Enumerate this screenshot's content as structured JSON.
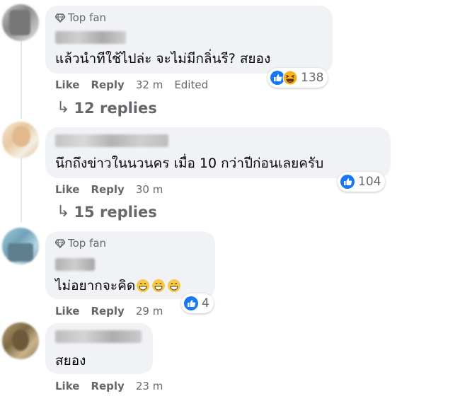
{
  "comments": [
    {
      "badge": "Top fan",
      "text": "แล้วนำทีใช้ไปล่ะ จะไม่มีกลิ่นรี? สยอง",
      "reactions": {
        "icons": [
          "like",
          "haha"
        ],
        "count": "138"
      },
      "actions": {
        "like": "Like",
        "reply": "Reply",
        "time": "32 m",
        "edited": "Edited"
      },
      "replies": {
        "arrow": "↳",
        "label": "12 replies"
      }
    },
    {
      "text": "นึกถึงข่าวในนวนคร เมื่อ 10 กว่าปีก่อนเลยครับ",
      "reactions": {
        "icons": [
          "like"
        ],
        "count": "104"
      },
      "actions": {
        "like": "Like",
        "reply": "Reply",
        "time": "30 m"
      },
      "replies": {
        "arrow": "↳",
        "label": "15 replies"
      }
    },
    {
      "badge": "Top fan",
      "text": "ไม่อยากจะคิด",
      "emojis": [
        "grin",
        "grin",
        "grin"
      ],
      "reactions": {
        "icons": [
          "like"
        ],
        "count": "4"
      },
      "actions": {
        "like": "Like",
        "reply": "Reply",
        "time": "29 m"
      }
    },
    {
      "text": "สยอง",
      "actions": {
        "like": "Like",
        "reply": "Reply",
        "time": "23 m"
      }
    }
  ],
  "colors": {
    "bubble": "#f0f2f5",
    "meta": "#65676b",
    "like_blue": "#1877f2",
    "haha_yellow": "#f7b125"
  }
}
